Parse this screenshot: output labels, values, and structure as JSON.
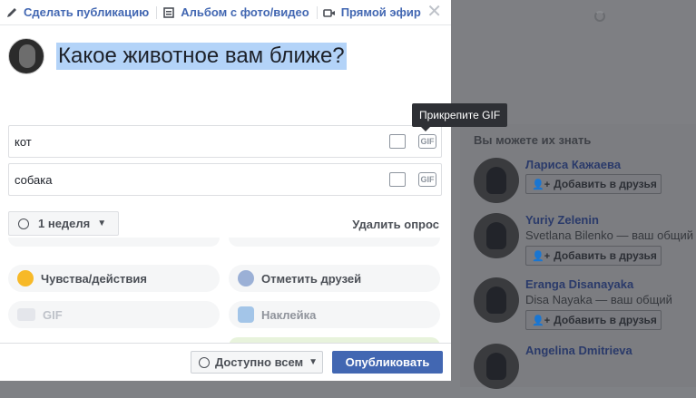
{
  "composer": {
    "tabs": [
      {
        "label": "Сделать публикацию",
        "icon": "pencil-icon"
      },
      {
        "label": "Альбом с фото/видео",
        "icon": "album-icon"
      },
      {
        "label": "Прямой эфир",
        "icon": "video-camera-icon"
      }
    ],
    "question": "Какое животное вам ближе?",
    "options": [
      {
        "value": "кот"
      },
      {
        "value": "собака"
      }
    ],
    "tooltip": "Прикрепите GIF",
    "gif_icon_text": "GIF",
    "duration": "1 неделя",
    "delete_poll": "Удалить опрос",
    "actions": [
      {
        "label": "Чувства/действия",
        "icon": "smiley-icon",
        "color": "#f7b928"
      },
      {
        "label": "Отметить друзей",
        "icon": "tag-friends-icon",
        "color": "#1877f2"
      },
      {
        "label": "GIF",
        "icon": "gif-icon",
        "color": "#bec2c9"
      },
      {
        "label": "Наклейка",
        "icon": "sticker-icon",
        "color": "#a3c5e8"
      }
    ],
    "privacy": "Доступно всем",
    "publish": "Опубликовать"
  },
  "suggestions": {
    "title": "Вы можете их знать",
    "add_label": "Добавить в друзья",
    "people": [
      {
        "name": "Лариса Кажаева",
        "mutual": ""
      },
      {
        "name": "Yuriy Zelenin",
        "mutual": "Svetlana Bilenko — ваш общий"
      },
      {
        "name": "Eranga Disanayaka",
        "mutual": "Disa Nayaka — ваш общий"
      },
      {
        "name": "Angelina Dmitrieva",
        "mutual": ""
      }
    ]
  },
  "colors": {
    "accent": "#4267b2",
    "highlight": "#b3d3f8"
  }
}
